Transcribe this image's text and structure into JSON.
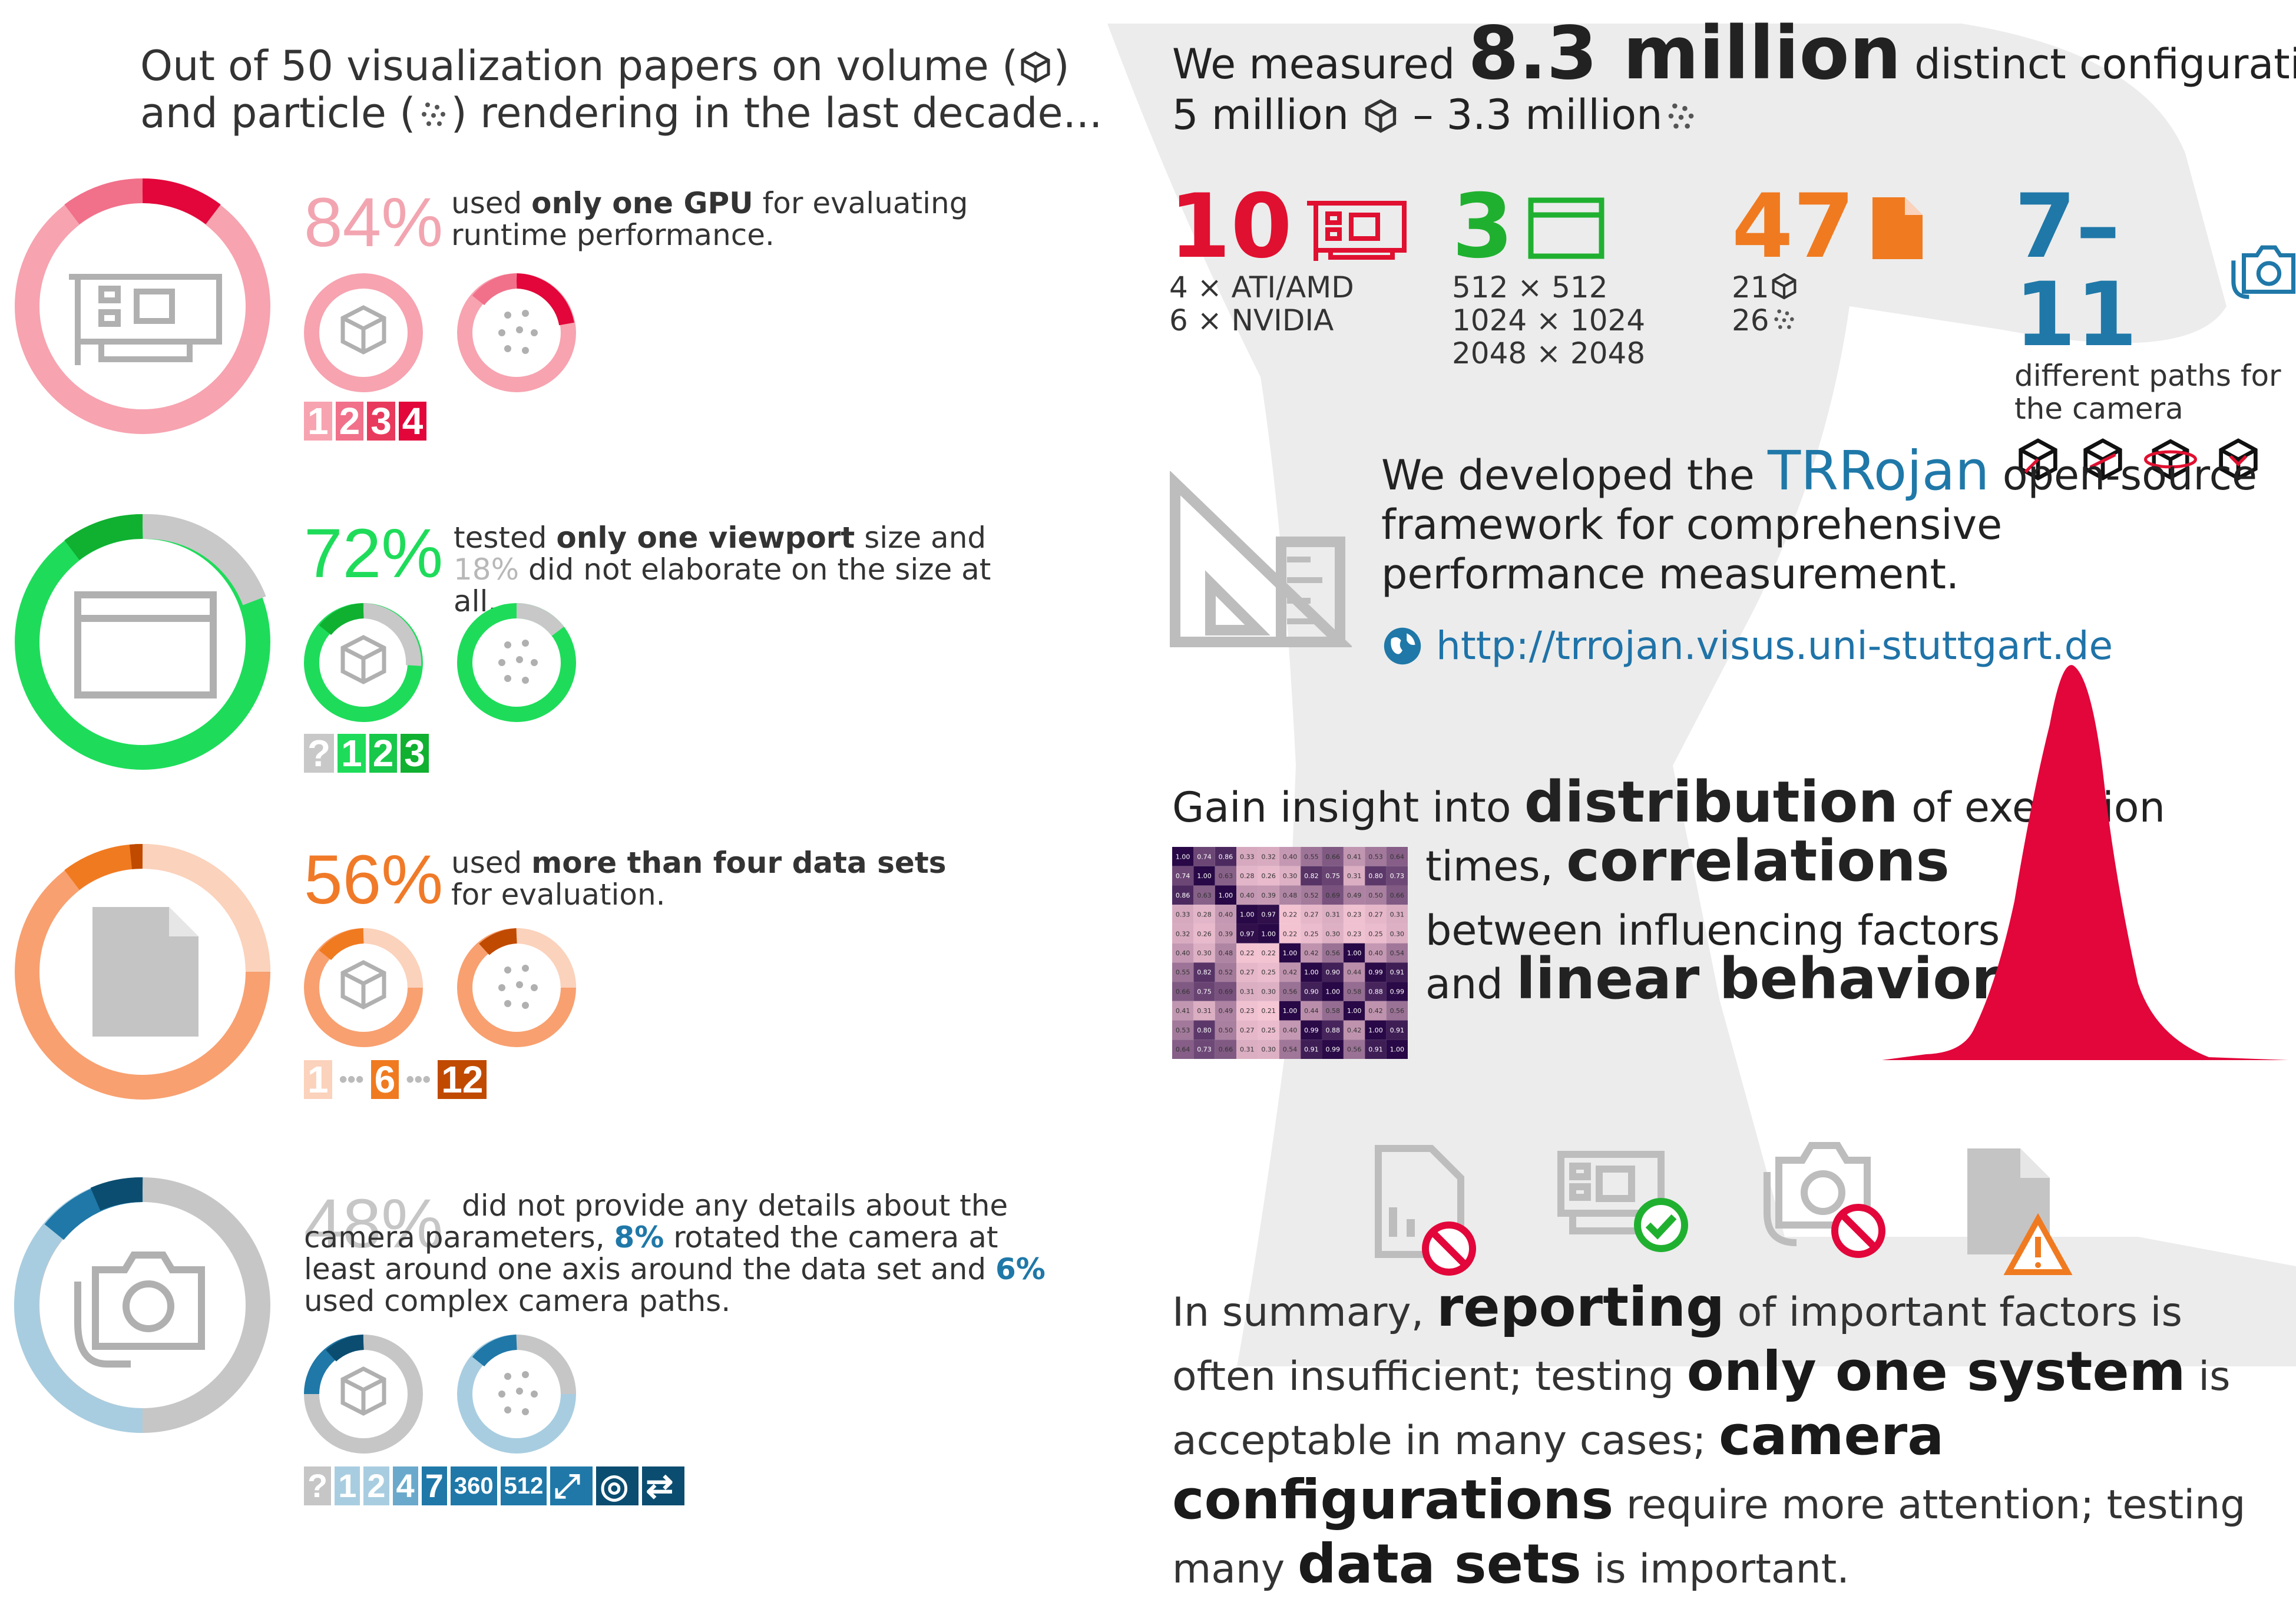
{
  "intro": {
    "line1": "Out of 50 visualization papers on volume (",
    "line1_end": ")",
    "line2": "and particle (",
    "line2_end": ") rendering in the last decade..."
  },
  "sections": [
    {
      "pct": "84%",
      "color": "#f2a5b0",
      "desc_pre": "used ",
      "desc_bold": "only one GPU",
      "desc_post": " for evaluating runtime performance.",
      "nums": [
        "1",
        "2",
        "3",
        "4"
      ]
    },
    {
      "pct": "72%",
      "color": "#1edc5a",
      "desc_pre": "tested ",
      "desc_bold": "only one viewport",
      "desc_post": " size and ",
      "desc_grey": "18%",
      "desc_post2": " did not elaborate on the size at all.",
      "nums": [
        "?",
        "1",
        "2",
        "3"
      ]
    },
    {
      "pct": "56%",
      "color": "#f07a28",
      "desc_pre": "used ",
      "desc_bold": "more than four data sets",
      "desc_post": " for evaluation.",
      "nums": [
        "1",
        "•••",
        "6",
        "•••",
        "12"
      ]
    },
    {
      "pct": "48%",
      "color": "#c6c6c6",
      "desc_pre": "did not provide any details about the camera parameters, ",
      "desc_hl1": "8%",
      "desc_mid": " rotated the camera at least around one axis around the data set and ",
      "desc_hl2": "6%",
      "desc_post": " used complex camera paths.",
      "nums": [
        "?",
        "1",
        "2",
        "4",
        "7",
        "360",
        "512"
      ]
    }
  ],
  "right": {
    "head_pre": "We measured ",
    "head_big": "8.3 million",
    "head_post": " distinct configurations:",
    "head_line2_a": "5 million ",
    "head_line2_b": " – 3.3 million",
    "stats": [
      {
        "num": "10",
        "color": "#e01030",
        "lines": "4 × ATI/AMD\n6 × NVIDIA",
        "icon": "gpu-card-icon"
      },
      {
        "num": "3",
        "color": "#20b030",
        "lines": "512 × 512\n1024 × 1024\n2048 × 2048",
        "icon": "window-icon"
      },
      {
        "num": "47",
        "color": "#f07a20",
        "line_a": "21",
        "line_b": "26",
        "icon": "document-icon"
      },
      {
        "num": "7–11",
        "color": "#1f78a8",
        "lines": "different paths for\nthe camera",
        "icon": "camera-icon"
      }
    ],
    "dev_pre": "We developed the ",
    "dev_name": "TRRojan",
    "dev_post": " open-source framework for comprehensive performance measurement.",
    "url": "http://trrojan.visus.uni-stuttgart.de",
    "gain_l1_pre": "Gain insight into ",
    "gain_l1_big": "distribution",
    "gain_l1_post": " of execution",
    "gain_l2_pre": "times, ",
    "gain_l2_big": "correlations",
    "gain_l3": "between influencing factors",
    "gain_l4_pre": "and ",
    "gain_l4_big": "linear behavior.",
    "summary_1": "In summary, ",
    "summary_b1": "reporting",
    "summary_2": " of important factors is often insufficient; testing ",
    "summary_b2": "only one system",
    "summary_3": " is acceptable in many cases; ",
    "summary_b3": "camera configurations",
    "summary_4": " require more attention; testing many ",
    "summary_b4": "data sets",
    "summary_5": " is important."
  },
  "heatmap": [
    [
      "1.00",
      "0.74",
      "0.86",
      "0.33",
      "0.32",
      "0.40",
      "0.55",
      "0.66",
      "0.41",
      "0.53",
      "0.64"
    ],
    [
      "0.74",
      "1.00",
      "0.63",
      "0.28",
      "0.26",
      "0.30",
      "0.82",
      "0.75",
      "0.31",
      "0.80",
      "0.73"
    ],
    [
      "0.86",
      "0.63",
      "1.00",
      "0.40",
      "0.39",
      "0.48",
      "0.52",
      "0.69",
      "0.49",
      "0.50",
      "0.66"
    ],
    [
      "0.33",
      "0.28",
      "0.40",
      "1.00",
      "0.97",
      "0.22",
      "0.27",
      "0.31",
      "0.23",
      "0.27",
      "0.31"
    ],
    [
      "0.32",
      "0.26",
      "0.39",
      "0.97",
      "1.00",
      "0.22",
      "0.25",
      "0.30",
      "0.23",
      "0.25",
      "0.30"
    ],
    [
      "0.40",
      "0.30",
      "0.48",
      "0.22",
      "0.22",
      "1.00",
      "0.42",
      "0.56",
      "1.00",
      "0.40",
      "0.54"
    ],
    [
      "0.55",
      "0.82",
      "0.52",
      "0.27",
      "0.25",
      "0.42",
      "1.00",
      "0.90",
      "0.44",
      "0.99",
      "0.91"
    ],
    [
      "0.66",
      "0.75",
      "0.69",
      "0.31",
      "0.30",
      "0.56",
      "0.90",
      "1.00",
      "0.58",
      "0.88",
      "0.99"
    ],
    [
      "0.41",
      "0.31",
      "0.49",
      "0.23",
      "0.21",
      "1.00",
      "0.44",
      "0.58",
      "1.00",
      "0.42",
      "0.56"
    ],
    [
      "0.53",
      "0.80",
      "0.50",
      "0.27",
      "0.25",
      "0.40",
      "0.99",
      "0.88",
      "0.42",
      "1.00",
      "0.91"
    ],
    [
      "0.64",
      "0.73",
      "0.66",
      "0.31",
      "0.30",
      "0.54",
      "0.91",
      "0.99",
      "0.56",
      "0.91",
      "1.00"
    ]
  ]
}
